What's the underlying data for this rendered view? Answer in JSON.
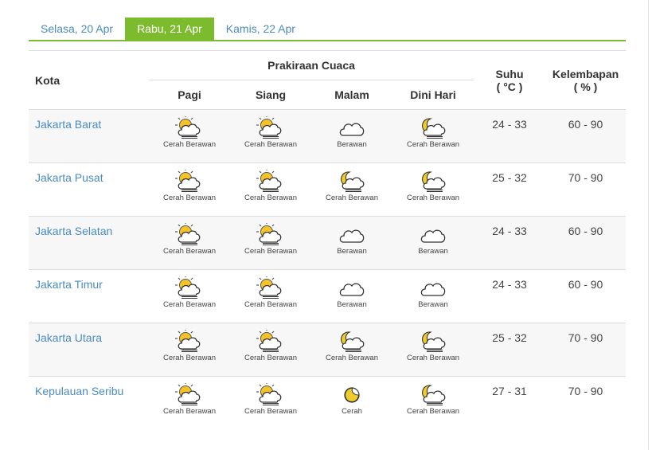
{
  "tabs": [
    {
      "label": "Selasa, 20 Apr",
      "active": false
    },
    {
      "label": "Rabu, 21 Apr",
      "active": true
    },
    {
      "label": "Kamis, 22 Apr",
      "active": false
    }
  ],
  "header": {
    "kota": "Kota",
    "prakiraan": "Prakiraan Cuaca",
    "periods": [
      "Pagi",
      "Siang",
      "Malam",
      "Dini Hari"
    ],
    "suhu": "Suhu",
    "suhu_unit": "( °C )",
    "kelembapan": "Kelembapan",
    "kelembapan_unit": "( % )"
  },
  "rows": [
    {
      "city": "Jakarta Barat",
      "forecast": [
        {
          "icon": "sun-cloud-rain-icon",
          "label": "Cerah Berawan"
        },
        {
          "icon": "sun-cloud-rain-icon",
          "label": "Cerah Berawan"
        },
        {
          "icon": "cloud-icon",
          "label": "Berawan"
        },
        {
          "icon": "moon-cloud-rain-icon",
          "label": "Cerah Berawan"
        }
      ],
      "suhu": "24 - 33",
      "kelembapan": "60 - 90"
    },
    {
      "city": "Jakarta Pusat",
      "forecast": [
        {
          "icon": "sun-cloud-rain-icon",
          "label": "Cerah Berawan"
        },
        {
          "icon": "sun-cloud-rain-icon",
          "label": "Cerah Berawan"
        },
        {
          "icon": "moon-cloud-rain-icon",
          "label": "Cerah Berawan"
        },
        {
          "icon": "moon-cloud-rain-icon",
          "label": "Cerah Berawan"
        }
      ],
      "suhu": "25 - 32",
      "kelembapan": "70 - 90"
    },
    {
      "city": "Jakarta Selatan",
      "forecast": [
        {
          "icon": "sun-cloud-rain-icon",
          "label": "Cerah Berawan"
        },
        {
          "icon": "sun-cloud-rain-icon",
          "label": "Cerah Berawan"
        },
        {
          "icon": "cloud-icon",
          "label": "Berawan"
        },
        {
          "icon": "cloud-icon",
          "label": "Berawan"
        }
      ],
      "suhu": "24 - 33",
      "kelembapan": "60 - 90"
    },
    {
      "city": "Jakarta Timur",
      "forecast": [
        {
          "icon": "sun-cloud-rain-icon",
          "label": "Cerah Berawan"
        },
        {
          "icon": "sun-cloud-rain-icon",
          "label": "Cerah Berawan"
        },
        {
          "icon": "cloud-icon",
          "label": "Berawan"
        },
        {
          "icon": "cloud-icon",
          "label": "Berawan"
        }
      ],
      "suhu": "24 - 33",
      "kelembapan": "60 - 90"
    },
    {
      "city": "Jakarta Utara",
      "forecast": [
        {
          "icon": "sun-cloud-rain-icon",
          "label": "Cerah Berawan"
        },
        {
          "icon": "sun-cloud-rain-icon",
          "label": "Cerah Berawan"
        },
        {
          "icon": "moon-cloud-rain-icon",
          "label": "Cerah Berawan"
        },
        {
          "icon": "moon-cloud-rain-icon",
          "label": "Cerah Berawan"
        }
      ],
      "suhu": "25 - 32",
      "kelembapan": "70 - 90"
    },
    {
      "city": "Kepulauan Seribu",
      "forecast": [
        {
          "icon": "sun-cloud-rain-icon",
          "label": "Cerah Berawan"
        },
        {
          "icon": "sun-cloud-rain-icon",
          "label": "Cerah Berawan"
        },
        {
          "icon": "moon-icon",
          "label": "Cerah"
        },
        {
          "icon": "moon-cloud-rain-icon",
          "label": "Cerah Berawan"
        }
      ],
      "suhu": "27 - 31",
      "kelembapan": "70 - 90"
    }
  ],
  "colors": {
    "accent": "#7dbb2e",
    "link": "#4a8cc2",
    "sun": "#f5c22a",
    "moon": "#f0cb2d"
  }
}
